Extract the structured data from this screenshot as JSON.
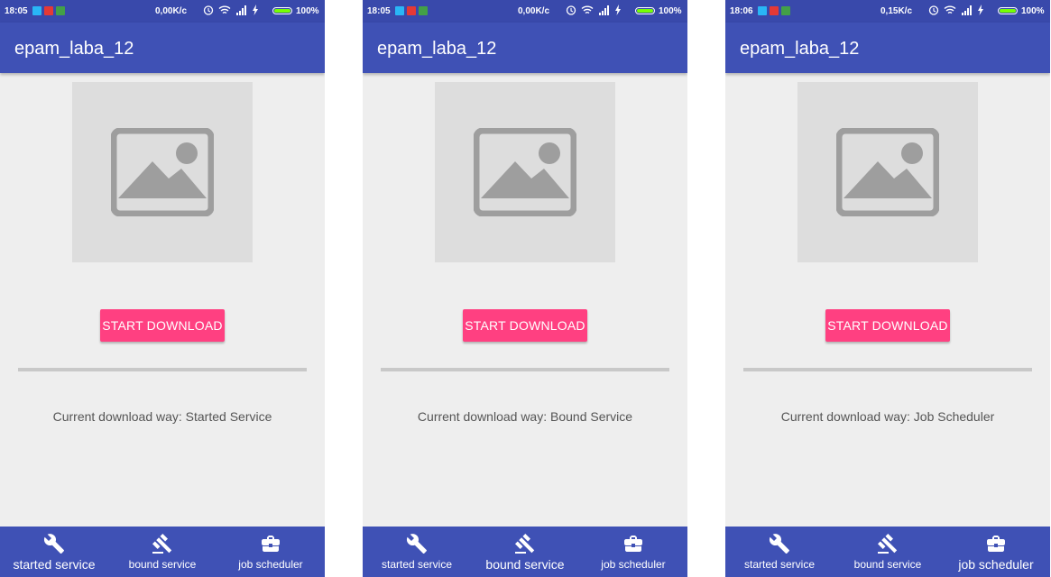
{
  "screens": [
    {
      "status": {
        "time": "18:05",
        "network": "0,00K/c",
        "battery": "100%"
      },
      "app_title": "epam_laba_12",
      "button_label": "START DOWNLOAD",
      "progress": 0,
      "download_way": "Current download way: Started Service",
      "nav": [
        {
          "label": "started service",
          "icon": "wrench-icon",
          "active": true
        },
        {
          "label": "bound service",
          "icon": "gavel-icon",
          "active": false
        },
        {
          "label": "job scheduler",
          "icon": "briefcase-icon",
          "active": false
        }
      ]
    },
    {
      "status": {
        "time": "18:05",
        "network": "0,00K/c",
        "battery": "100%"
      },
      "app_title": "epam_laba_12",
      "button_label": "START DOWNLOAD",
      "progress": 0,
      "download_way": "Current download way: Bound Service",
      "nav": [
        {
          "label": "started service",
          "icon": "wrench-icon",
          "active": false
        },
        {
          "label": "bound service",
          "icon": "gavel-icon",
          "active": true
        },
        {
          "label": "job scheduler",
          "icon": "briefcase-icon",
          "active": false
        }
      ]
    },
    {
      "status": {
        "time": "18:06",
        "network": "0,15K/c",
        "battery": "100%"
      },
      "app_title": "epam_laba_12",
      "button_label": "START DOWNLOAD",
      "progress": 0,
      "download_way": "Current download way: Job Scheduler",
      "nav": [
        {
          "label": "started service",
          "icon": "wrench-icon",
          "active": false
        },
        {
          "label": "bound service",
          "icon": "gavel-icon",
          "active": false
        },
        {
          "label": "job scheduler",
          "icon": "briefcase-icon",
          "active": true
        }
      ]
    }
  ],
  "colors": {
    "status_bar": "#3949ab",
    "app_bar": "#3f51b5",
    "accent": "#ff4081",
    "background": "#eeeeee",
    "placeholder": "#dddddd",
    "placeholder_icon": "#9e9e9e"
  }
}
